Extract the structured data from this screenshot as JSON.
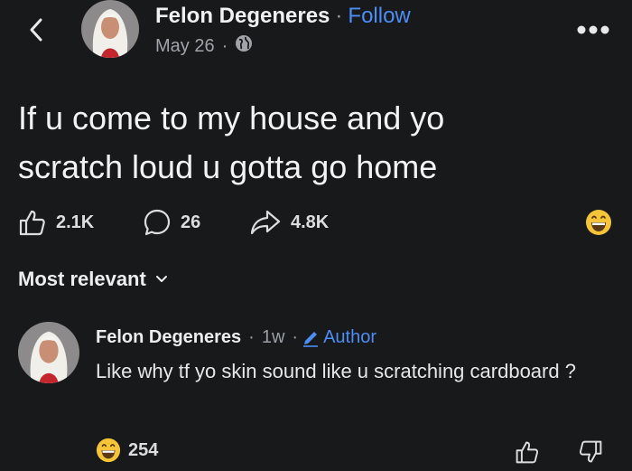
{
  "header": {
    "author": "Felon Degeneres",
    "separator": "·",
    "follow_label": "Follow",
    "date": "May 26",
    "meta_sep": "·",
    "privacy_icon": "globe-icon"
  },
  "post": {
    "text_line1": "If u come to my house and yo",
    "text_line2": "scratch loud u gotta go home",
    "likes": "2.1K",
    "comments": "26",
    "shares": "4.8K",
    "reaction_icon": "grin-emoji-icon"
  },
  "comments_section": {
    "sort_label": "Most relevant"
  },
  "comment": {
    "author": "Felon Degeneres",
    "time": "1w",
    "time_sep": "·",
    "author_badge": "Author",
    "text": "Like why tf yo skin sound like u scratching cardboard ?",
    "reaction_count": "254",
    "reaction_icon": "grin-emoji-icon"
  },
  "colors": {
    "background": "#18191b",
    "accent": "#4c8df6",
    "text": "#e8e9eb",
    "muted": "#a0a4aa"
  }
}
